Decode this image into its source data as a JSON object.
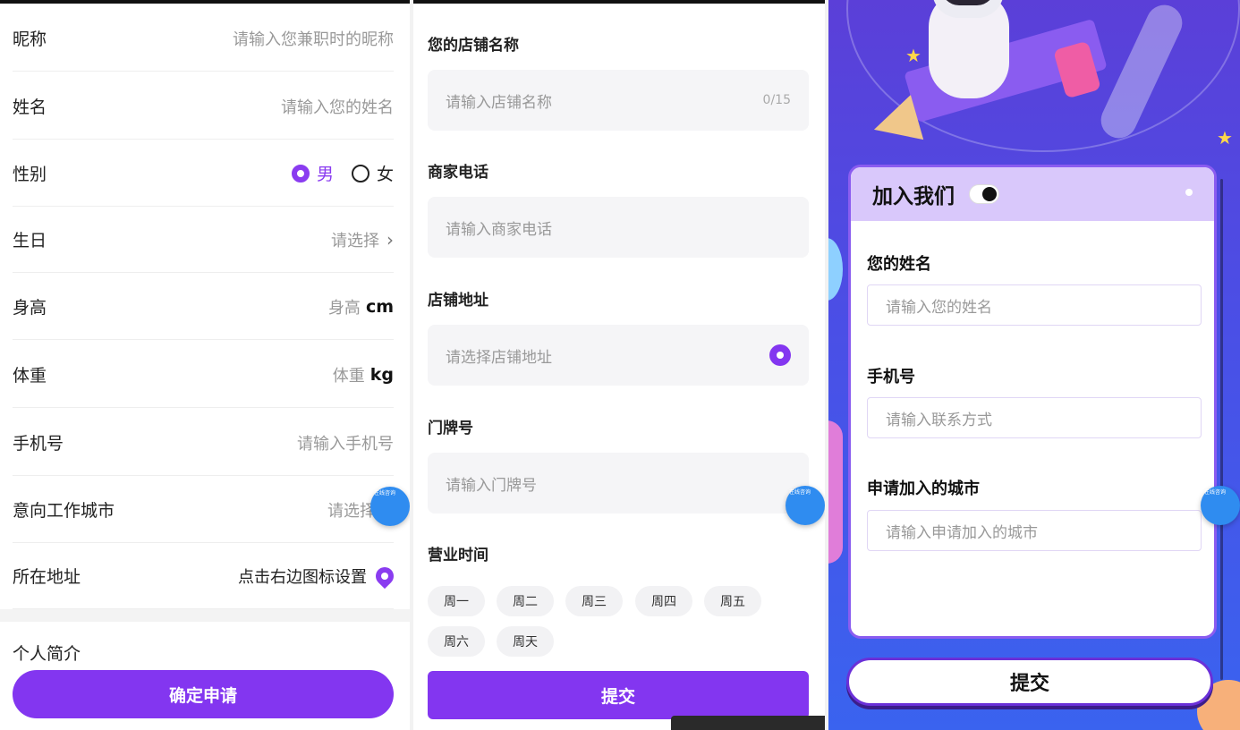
{
  "panel1": {
    "rows": [
      {
        "label": "昵称",
        "value": "请输入您兼职时的昵称"
      },
      {
        "label": "姓名",
        "value": "请输入您的姓名"
      },
      {
        "label": "性别",
        "male": "男",
        "female": "女"
      },
      {
        "label": "生日",
        "value": "请选择",
        "chevron": "›"
      },
      {
        "label": "身高",
        "value": "身高",
        "unit": "cm"
      },
      {
        "label": "体重",
        "value": "体重",
        "unit": "kg"
      },
      {
        "label": "手机号",
        "value": "请输入手机号"
      },
      {
        "label": "意向工作城市",
        "value": "请选择"
      },
      {
        "label": "所在地址",
        "value": "点击右边图标设置"
      }
    ],
    "intro_label": "个人简介",
    "submit": "确定申请",
    "fab_tag": "在线咨询",
    "accent": "#8336f0"
  },
  "panel2": {
    "store_name": {
      "label": "您的店铺名称",
      "placeholder": "请输入店铺名称",
      "counter": "0/15"
    },
    "phone": {
      "label": "商家电话",
      "placeholder": "请输入商家电话"
    },
    "address": {
      "label": "店铺地址",
      "placeholder": "请选择店铺地址"
    },
    "door": {
      "label": "门牌号",
      "placeholder": "请输入门牌号"
    },
    "hours": {
      "label": "营业时间",
      "days": [
        "周一",
        "周二",
        "周三",
        "周四",
        "周五",
        "周六",
        "周天"
      ]
    },
    "submit": "提交",
    "fab_tag": "在线咨询"
  },
  "panel3": {
    "card_title": "加入我们",
    "fields": [
      {
        "label": "您的姓名",
        "placeholder": "请输入您的姓名"
      },
      {
        "label": "手机号",
        "placeholder": "请输入联系方式"
      },
      {
        "label": "申请加入的城市",
        "placeholder": "请输入申请加入的城市"
      }
    ],
    "submit": "提交",
    "fab_tag": "在线咨询"
  }
}
